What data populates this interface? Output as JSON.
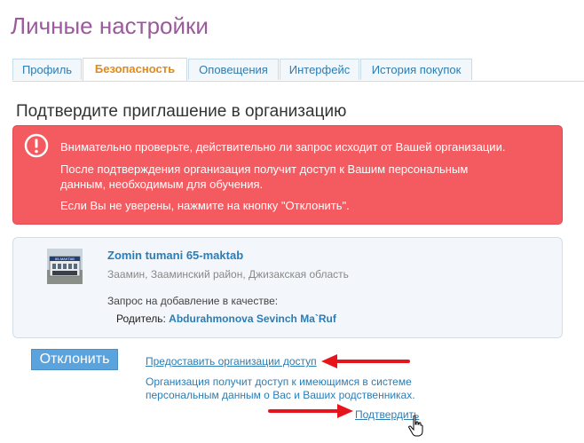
{
  "page": {
    "title": "Личные настройки"
  },
  "tabs": [
    {
      "label": "Профиль",
      "active": false
    },
    {
      "label": "Безопасность",
      "active": true
    },
    {
      "label": "Оповещения",
      "active": false
    },
    {
      "label": "Интерфейс",
      "active": false
    },
    {
      "label": "История покупок",
      "active": false
    }
  ],
  "section": {
    "title": "Подтвердите приглашение в организацию"
  },
  "alert": {
    "icon": "exclamation-circle-icon",
    "color": "#f45b60",
    "line1": "Внимательно проверьте, действительно ли запрос исходит от Вашей организации.",
    "line2": "После подтверждения организация получит доступ к Вашим персональным",
    "line3": "данным, необходимым для обучения.",
    "line4": "Если Вы не уверены, нажмите на кнопку \"Отклонить\"."
  },
  "organization": {
    "name": "Zomin tumani 65-maktab",
    "address": "Заамин, Зааминский район, Джизакская область",
    "photo_sign": "65-MAKTAB",
    "request_label": "Запрос на добавление в качестве:",
    "role_label": "Родитель:",
    "role_name": "Abdurahmonova Sevinch Ma`Ruf"
  },
  "actions": {
    "decline_label": "Отклонить",
    "grant_link": "Предоставить организации доступ",
    "grant_desc_line1": "Организация получит доступ к имеющимся в системе",
    "grant_desc_line2": "персональным данным о Вас и Ваших родственниках.",
    "confirm_link": "Подтвердить"
  },
  "colors": {
    "accent": "#2b7db5",
    "title": "#9b5a9b",
    "active_tab": "#e08a1e",
    "button": "#5ba3dd",
    "annotation_arrow": "#e8141c"
  }
}
